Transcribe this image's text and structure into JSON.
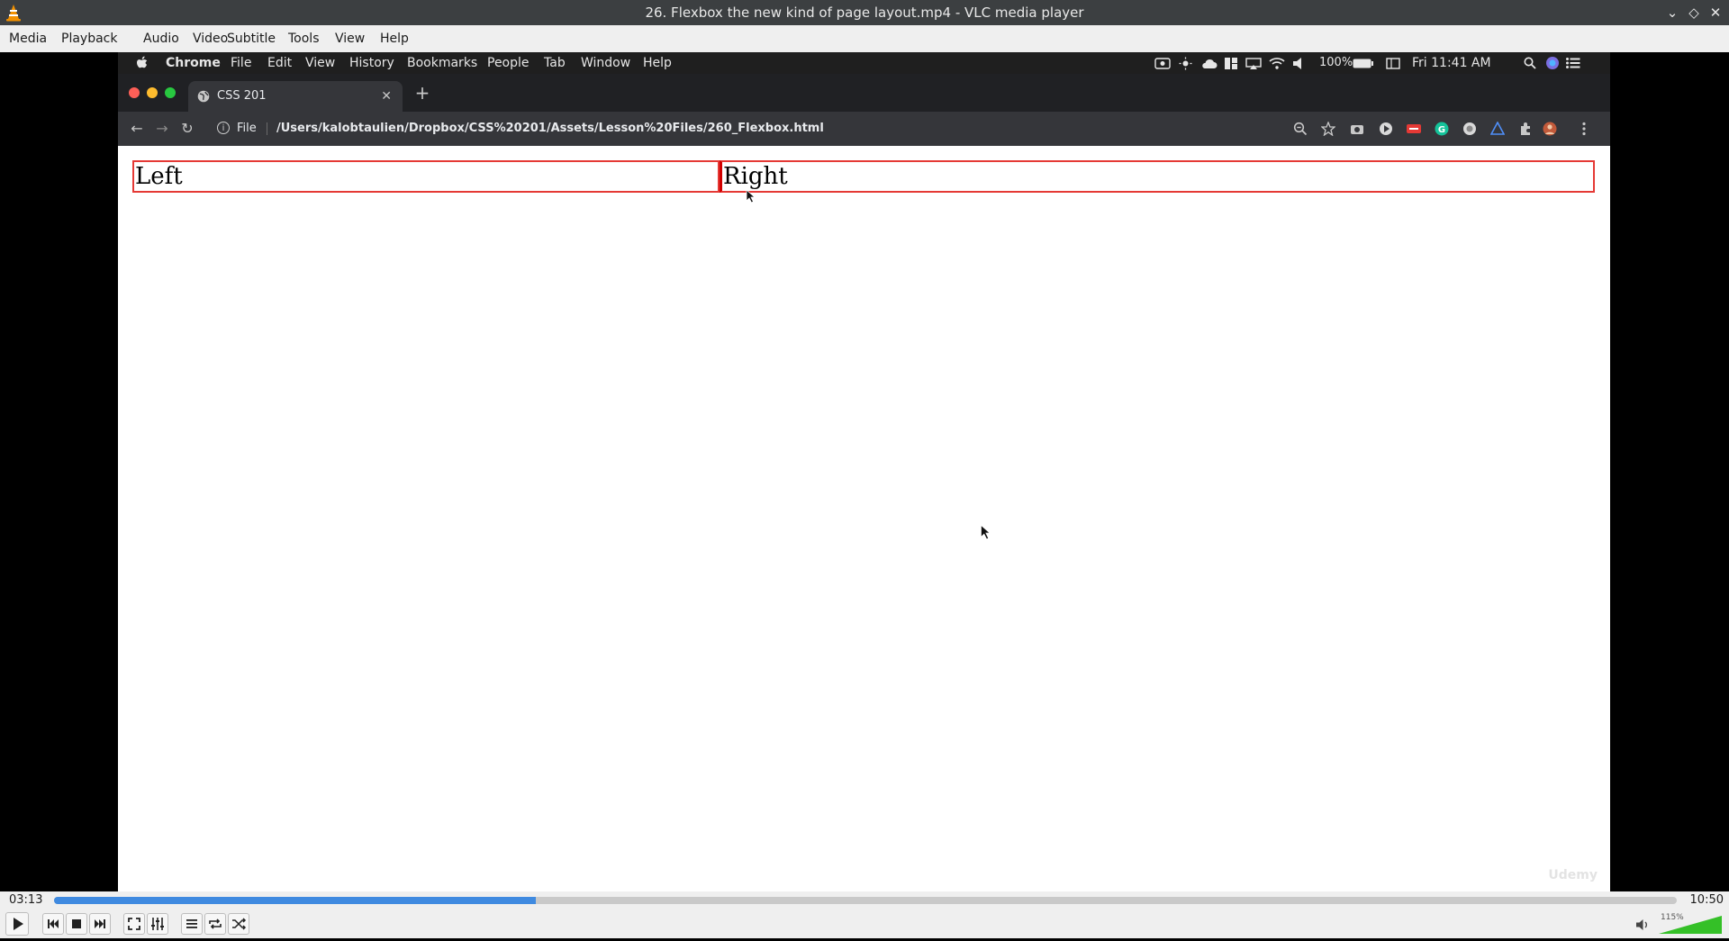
{
  "window": {
    "title": "26. Flexbox the new kind of page layout.mp4 - VLC media player"
  },
  "menu": [
    "Media",
    "Playback",
    "Audio",
    "Video",
    "Subtitle",
    "Tools",
    "View",
    "Help"
  ],
  "mac_menubar": {
    "items": [
      "Chrome",
      "File",
      "Edit",
      "View",
      "History",
      "Bookmarks",
      "People",
      "Tab",
      "Window",
      "Help"
    ],
    "battery": "100%",
    "clock": "Fri 11:41 AM"
  },
  "chrome": {
    "tab_title": "CSS 201",
    "address_scheme": "File",
    "url": "/Users/kalobtaulien/Dropbox/CSS%20201/Assets/Lesson%20Files/260_Flexbox.html"
  },
  "page": {
    "left_text": "Left",
    "right_text": "Right",
    "watermark": "Udemy"
  },
  "player": {
    "elapsed": "03:13",
    "total": "10:50",
    "progress_fraction": 0.297,
    "volume_label": "115%",
    "volume_fraction": 1.0,
    "accent_color": "#3f8ae0"
  }
}
